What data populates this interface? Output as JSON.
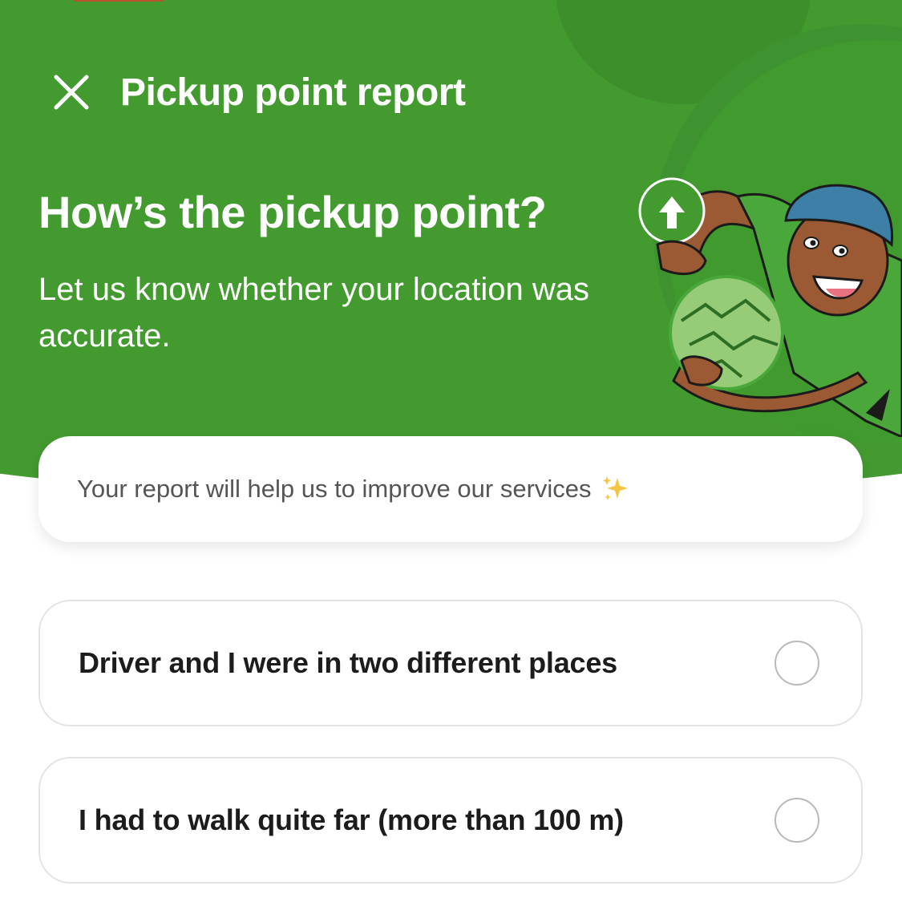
{
  "header": {
    "title": "Pickup point report",
    "close_icon": "close-icon"
  },
  "hero": {
    "headline": "How’s the pickup point?",
    "subhead": "Let us know whether your location was accurate.",
    "illustration_icon": "person-holding-map-illustration"
  },
  "info_card": {
    "text": "Your report will help us to improve our services",
    "icon": "sparkles-icon"
  },
  "options": [
    {
      "label": "Driver and I were in two different places",
      "selected": false
    },
    {
      "label": "I had to walk quite far (more than 100 m)",
      "selected": false
    }
  ],
  "colors": {
    "brand_green": "#439b30",
    "text_dark": "#1c1c1c",
    "text_muted": "#555555",
    "border": "#e3e3e3"
  }
}
